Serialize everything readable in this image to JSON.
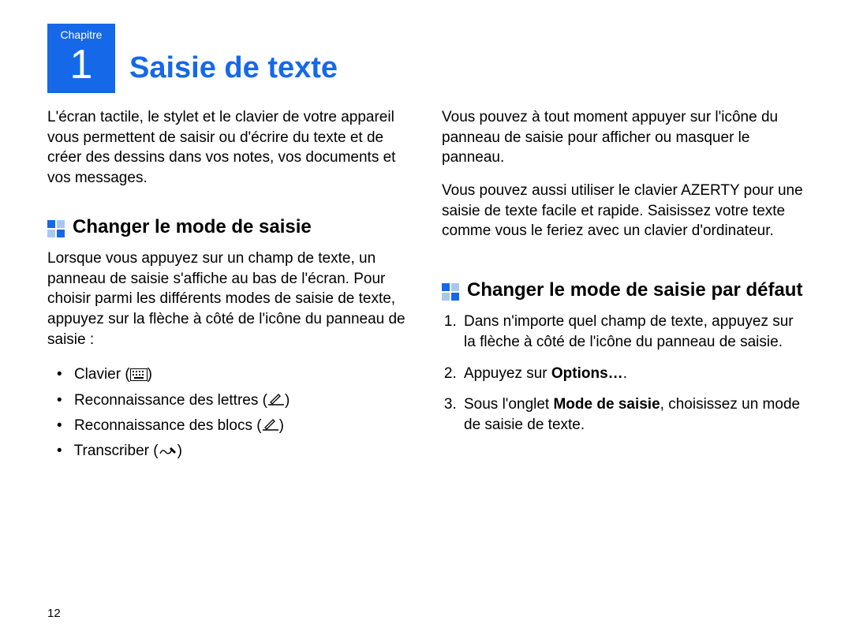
{
  "chapter": {
    "label": "Chapitre",
    "number": "1",
    "title": "Saisie de texte"
  },
  "left": {
    "intro": "L'écran tactile, le stylet et le clavier de votre appareil vous permettent de saisir ou d'écrire du texte et de créer des dessins dans vos notes, vos documents et vos messages.",
    "section1_title": "Changer le mode de saisie",
    "section1_para": "Lorsque vous appuyez sur un champ de texte, un panneau de saisie s'affiche au bas de l'écran. Pour choisir parmi les différents modes de saisie de texte, appuyez sur la flèche à côté de l'icône du panneau de saisie :",
    "opts": {
      "o1_pre": "Clavier (",
      "o2_pre": "Reconnaissance des lettres (",
      "o3_pre": "Reconnaissance des blocs (",
      "o4_pre": "Transcriber (",
      "close": ")"
    }
  },
  "right": {
    "p1": "Vous pouvez à tout moment appuyer sur l'icône du panneau de saisie pour afficher ou masquer le panneau.",
    "p2": "Vous pouvez aussi utiliser le clavier AZERTY pour une saisie de texte facile et rapide. Saisissez votre texte comme vous le feriez avec un clavier d'ordinateur.",
    "section2_title": "Changer le mode de saisie par défaut",
    "steps": {
      "s1": "Dans n'importe quel champ de texte, appuyez sur la flèche à côté de l'icône du panneau de saisie.",
      "s2_pre": "Appuyez sur ",
      "s2_bold": "Options…",
      "s2_post": ".",
      "s3_pre": "Sous l'onglet ",
      "s3_bold": "Mode de saisie",
      "s3_post": ", choisissez un mode de saisie de texte."
    }
  },
  "page_number": "12"
}
